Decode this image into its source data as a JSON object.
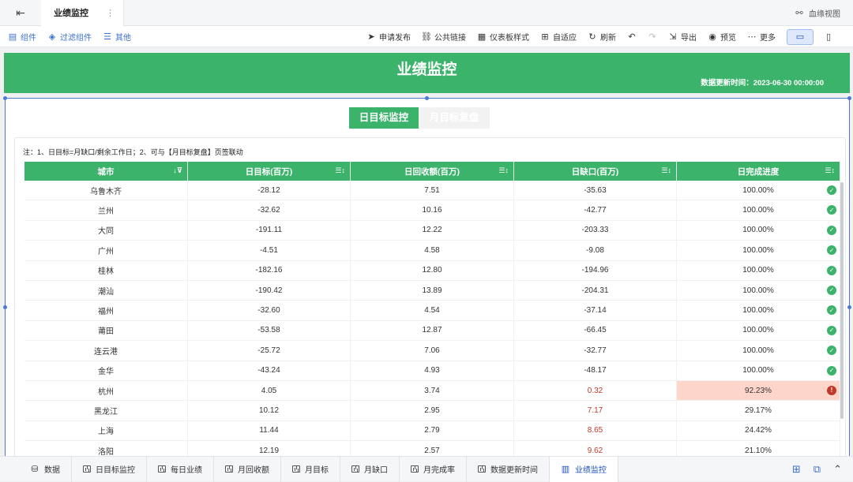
{
  "window": {
    "tab_title": "业绩监控",
    "lineage_label": "血缘视图"
  },
  "toolbar": {
    "left": [
      {
        "label": "组件",
        "icon": "component-icon"
      },
      {
        "label": "过滤组件",
        "icon": "filter-icon"
      },
      {
        "label": "其他",
        "icon": "other-icon"
      }
    ],
    "right": [
      {
        "label": "申请发布",
        "icon": "send-icon"
      },
      {
        "label": "公共链接",
        "icon": "link-icon"
      },
      {
        "label": "仪表板样式",
        "icon": "style-icon"
      },
      {
        "label": "自适应",
        "icon": "fit-icon"
      },
      {
        "label": "刷新",
        "icon": "refresh-icon"
      },
      {
        "label": "导出",
        "icon": "export-icon"
      },
      {
        "label": "预览",
        "icon": "preview-icon"
      },
      {
        "label": "更多",
        "icon": "more-icon"
      }
    ]
  },
  "banner": {
    "title": "业绩监控",
    "update_label": "数据更新时间：2023-06-30 00:00:00"
  },
  "tabs": [
    {
      "label": "日目标监控",
      "active": true
    },
    {
      "label": "月目标复盘",
      "active": false
    }
  ],
  "note": "注：1、日目标=月缺口/剩余工作日；2、可与【月目标复盘】页签联动",
  "table": {
    "headers": [
      "城市",
      "日目标(百万)",
      "日回收额(百万)",
      "日缺口(百万)",
      "日完成进度"
    ],
    "rows": [
      {
        "city": "乌鲁木齐",
        "target": "-28.12",
        "recv": "7.51",
        "gap": "-35.63",
        "progress": "100.00%",
        "status": "ok"
      },
      {
        "city": "兰州",
        "target": "-32.62",
        "recv": "10.16",
        "gap": "-42.77",
        "progress": "100.00%",
        "status": "ok"
      },
      {
        "city": "大同",
        "target": "-191.11",
        "recv": "12.22",
        "gap": "-203.33",
        "progress": "100.00%",
        "status": "ok"
      },
      {
        "city": "广州",
        "target": "-4.51",
        "recv": "4.58",
        "gap": "-9.08",
        "progress": "100.00%",
        "status": "ok"
      },
      {
        "city": "桂林",
        "target": "-182.16",
        "recv": "12.80",
        "gap": "-194.96",
        "progress": "100.00%",
        "status": "ok"
      },
      {
        "city": "潮汕",
        "target": "-190.42",
        "recv": "13.89",
        "gap": "-204.31",
        "progress": "100.00%",
        "status": "ok"
      },
      {
        "city": "福州",
        "target": "-32.60",
        "recv": "4.54",
        "gap": "-37.14",
        "progress": "100.00%",
        "status": "ok"
      },
      {
        "city": "莆田",
        "target": "-53.58",
        "recv": "12.87",
        "gap": "-66.45",
        "progress": "100.00%",
        "status": "ok"
      },
      {
        "city": "连云港",
        "target": "-25.72",
        "recv": "7.06",
        "gap": "-32.77",
        "progress": "100.00%",
        "status": "ok"
      },
      {
        "city": "金华",
        "target": "-43.24",
        "recv": "4.93",
        "gap": "-48.17",
        "progress": "100.00%",
        "status": "ok"
      },
      {
        "city": "杭州",
        "target": "4.05",
        "recv": "3.74",
        "gap": "0.32",
        "progress": "92.23%",
        "status": "bad"
      },
      {
        "city": "黑龙江",
        "target": "10.12",
        "recv": "2.95",
        "gap": "7.17",
        "progress": "29.17%",
        "status": "none"
      },
      {
        "city": "上海",
        "target": "11.44",
        "recv": "2.79",
        "gap": "8.65",
        "progress": "24.42%",
        "status": "none"
      },
      {
        "city": "洛阳",
        "target": "12.19",
        "recv": "2.57",
        "gap": "9.62",
        "progress": "21.10%",
        "status": "none"
      }
    ]
  },
  "bottom_tabs": [
    {
      "label": "数据",
      "icon": "database-icon"
    },
    {
      "label": "日目标监控",
      "icon": "chart-icon"
    },
    {
      "label": "每日业绩",
      "icon": "chart-icon"
    },
    {
      "label": "月回收额",
      "icon": "chart-icon"
    },
    {
      "label": "月目标",
      "icon": "chart-icon"
    },
    {
      "label": "月缺口",
      "icon": "chart-icon"
    },
    {
      "label": "月完成率",
      "icon": "chart-icon"
    },
    {
      "label": "数据更新时间",
      "icon": "chart-icon"
    },
    {
      "label": "业绩监控",
      "icon": "dashboard-icon",
      "active": true
    }
  ],
  "colors": {
    "accent_green": "#3bb36b",
    "warn_red": "#c0392b",
    "warn_bg": "#fdd5cb",
    "link_blue": "#3d6fd1"
  }
}
